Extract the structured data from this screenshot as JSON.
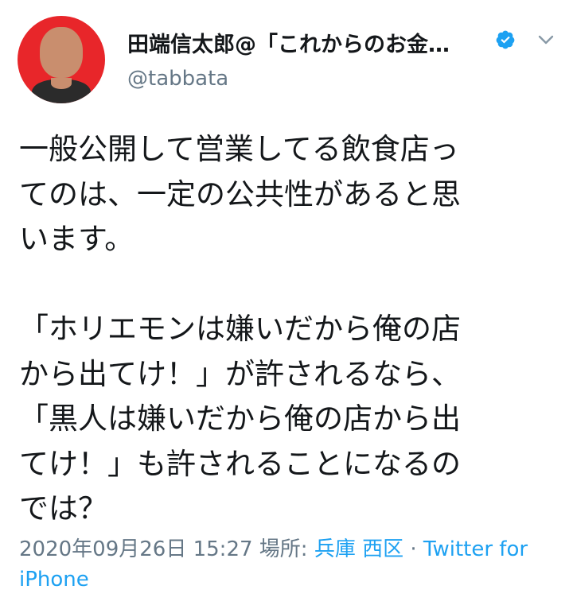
{
  "header": {
    "display_name": "田端信太郎@「これからのお金…",
    "handle": "@tabbata",
    "verified_icon": "verified-badge-icon",
    "menu_icon": "chevron-down-icon"
  },
  "tweet": {
    "text": "一般公開して営業してる飲食店っ\nてのは、一定の公共性があると思\nいます。\n\n「ホリエモンは嫌いだから俺の店\nから出てけ！」が許されるなら、\n「黒人は嫌いだから俺の店から出\nてけ！」も許されることになるの\nでは？"
  },
  "meta": {
    "datetime": "2020年09月26日 15:27",
    "place_label": "場所:",
    "place": "兵庫 西区",
    "separator": "·",
    "source": "Twitter for iPhone"
  },
  "colors": {
    "text": "#14171a",
    "secondary": "#657786",
    "link": "#1da1f2",
    "avatar_bg": "#e8262a"
  }
}
